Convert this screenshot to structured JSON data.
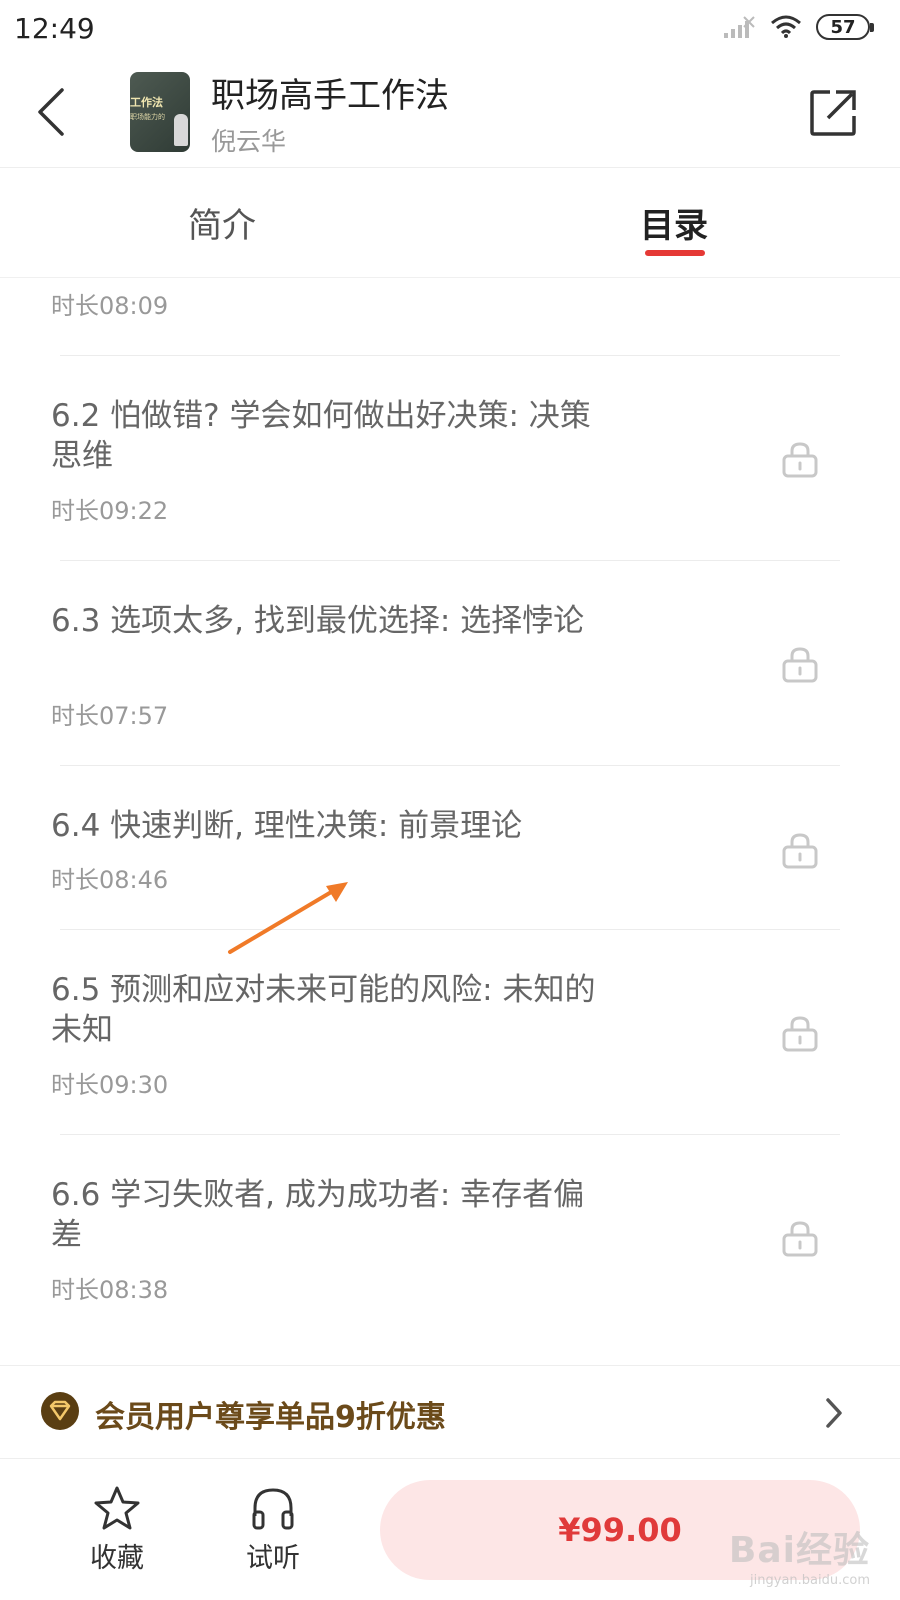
{
  "status_bar": {
    "time": "12:49",
    "battery": "57",
    "icons": [
      "signal-icon",
      "wifi-icon",
      "battery-icon"
    ]
  },
  "header": {
    "title": "职场高手工作法",
    "author": "倪云华",
    "cover_title": "工作法",
    "cover_subtitle": "职场能力的",
    "icons": [
      "back-arrow-icon",
      "share-icon"
    ]
  },
  "tabs": [
    {
      "label": "简介",
      "active": false
    },
    {
      "label": "目录",
      "active": true
    }
  ],
  "accent_color": "#e53935",
  "chapters": [
    {
      "title": "",
      "duration": "时长08:09",
      "locked": false
    },
    {
      "title": "6.2 怕做错? 学会如何做出好决策: 决策思维",
      "duration": "时长09:22",
      "locked": true
    },
    {
      "title": "6.3 选项太多, 找到最优选择: 选择悖论",
      "duration": "时长07:57",
      "locked": true
    },
    {
      "title": "6.4 快速判断, 理性决策: 前景理论",
      "duration": "时长08:46",
      "locked": true
    },
    {
      "title": "6.5 预测和应对未来可能的风险: 未知的未知",
      "duration": "时长09:30",
      "locked": true
    },
    {
      "title": "6.6 学习失败者, 成为成功者: 幸存者偏差",
      "duration": "时长08:38",
      "locked": true
    }
  ],
  "member_banner": {
    "text": "会员用户尊享单品9折优惠",
    "icon": "member-diamond-icon"
  },
  "bottom_bar": {
    "favorite_label": "收藏",
    "trial_label": "试听",
    "price": "¥99.00",
    "icons": [
      "star-icon",
      "headphones-icon"
    ]
  },
  "watermark": {
    "logo": "Bai经验",
    "url": "jingyan.baidu.com"
  }
}
